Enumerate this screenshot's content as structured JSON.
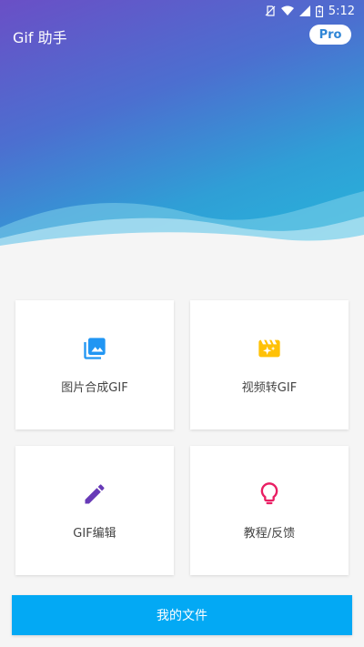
{
  "statusbar": {
    "time": "5:12",
    "icons": [
      "no-sim-icon",
      "wifi-icon",
      "signal-icon",
      "battery-icon"
    ]
  },
  "header": {
    "title": "Gif 助手",
    "pro_label": "Pro"
  },
  "cards": [
    {
      "label": "图片合成GIF",
      "icon": "photo-library-icon",
      "color": "#2196f3"
    },
    {
      "label": "视频转GIF",
      "icon": "movie-sparkle-icon",
      "color": "#ffc107"
    },
    {
      "label": "GIF编辑",
      "icon": "pencil-icon",
      "color": "#673ab7"
    },
    {
      "label": "教程/反馈",
      "icon": "lightbulb-icon",
      "color": "#e91e63"
    }
  ],
  "files_button": {
    "label": "我的文件",
    "color": "#03a9f4"
  }
}
